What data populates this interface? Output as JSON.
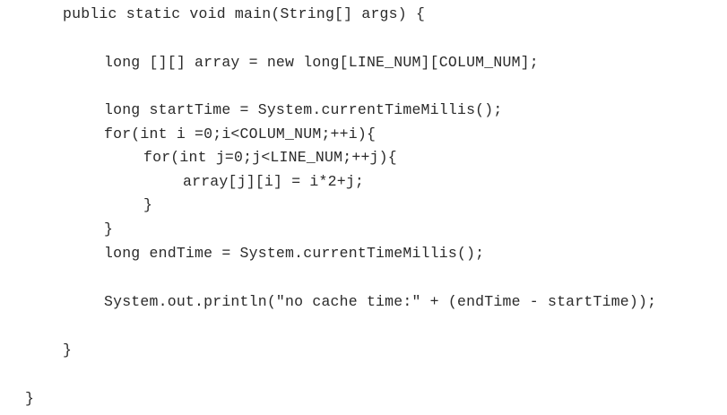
{
  "code": {
    "lines": [
      "public static void main(String[] args) {",
      "long [][] array = new long[LINE_NUM][COLUM_NUM];",
      "long startTime = System.currentTimeMillis();",
      "for(int i =0;i<COLUM_NUM;++i){",
      "for(int j=0;j<LINE_NUM;++j){",
      "array[j][i] = i*2+j;",
      "}",
      "}",
      "long endTime = System.currentTimeMillis();",
      "System.out.println(\"no cache time:\" + (endTime - startTime));",
      "}",
      "}"
    ]
  }
}
